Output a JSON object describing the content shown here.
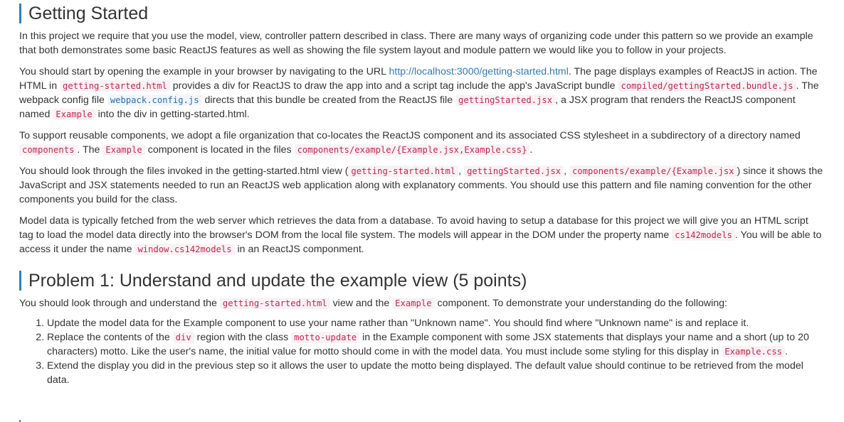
{
  "getting_started": {
    "heading": "Getting Started",
    "p1": "In this project we require that you use the model, view, controller pattern described in class. There are many ways of organizing code under this pattern so we provide an example that both demonstrates some basic ReactJS features as well as showing the file system layout and module pattern we would like you to follow in your projects.",
    "p2": {
      "t1": "You should start by opening the example in your browser by navigating to the URL ",
      "link": "http://localhost:3000/getting-started.html",
      "t2": ". The page displays examples of ReactJS in action. The HTML in ",
      "c1": "getting-started.html",
      "t3": " provides a div for ReactJS to draw the app into and a script tag include the app's JavaScript bundle ",
      "c2": "compiled/gettingStarted.bundle.js",
      "t4": ". The webpack config file ",
      "c3": "webpack.config.js",
      "t5": " directs that this bundle be created from the ReactJS file ",
      "c4": "gettingStarted.jsx",
      "t6": ", a JSX program that renders the ReactJS component named ",
      "c5": "Example",
      "t7": " into the div in getting-started.html."
    },
    "p3": {
      "t1": "To support reusable components, we adopt a file organization that co-locates the ReactJS component and its associated CSS stylesheet in a subdirectory of a directory named ",
      "c1": "components",
      "t2": ". The ",
      "c2": "Example",
      "t3": " component is located in the files ",
      "c3": "components/example/{Example.jsx,Example.css}",
      "t4": "."
    },
    "p4": {
      "t1": "You should look through the files invoked in the getting-started.html view (",
      "c1": "getting-started.html",
      "t2": ", ",
      "c2": "gettingStarted.jsx",
      "t3": ", ",
      "c3": "components/example/{Example.jsx",
      "t4": ") since it shows the JavaScript and JSX statements needed to run an ReactJS web application along with explanatory comments. You should use this pattern and file naming convention for the other components you build for the class."
    },
    "p5": {
      "t1": "Model data is typically fetched from the web server which retrieves the data from a database. To avoid having to setup a database for this project we will give you an HTML script tag to load the model data directly into the browser's DOM from the local file system. The models will appear in the DOM under the property name ",
      "c1": "cs142models",
      "t2": ". You will be able to access it under the name ",
      "c2": "window.cs142models",
      "t3": " in an ReactJS componment."
    }
  },
  "problem1": {
    "heading": "Problem 1: Understand and update the example view (5 points)",
    "intro": {
      "t1": "You should look through and understand the ",
      "c1": "getting-started.html",
      "t2": " view and the ",
      "c2": "Example",
      "t3": " component. To demonstrate your understanding do the following:"
    },
    "item1": "Update the model data for the Example component to use your name rather than \"Unknown name\". You should find where \"Unknown name\" is and replace it.",
    "item2": {
      "t1": "Replace the contents of the ",
      "c1": "div",
      "t2": " region with the class ",
      "c2": "motto-update",
      "t3": " in the Example component with some JSX statements that displays your name and a short (up to 20 characters) motto. Like the user's name, the initial value for motto should come in with the model data. You must include some styling for this display in ",
      "c3": "Example.css",
      "t4": "."
    },
    "item3": "Extend the display you did in the previous step so it allows the user to update the motto being displayed. The default value should continue to be retrieved from the model data."
  }
}
